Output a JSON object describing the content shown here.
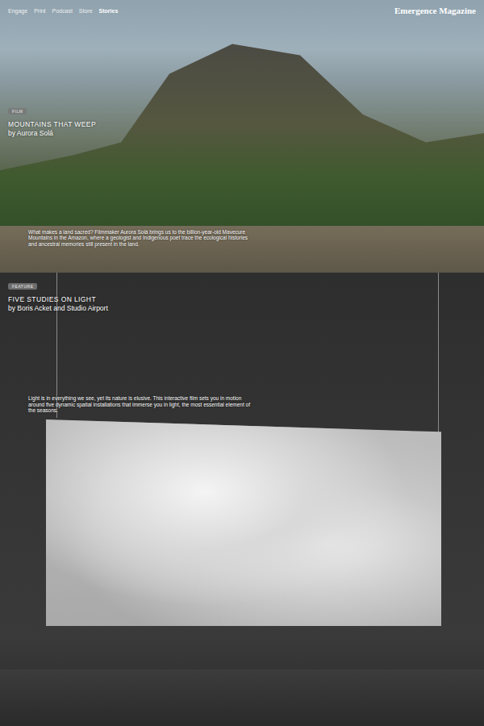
{
  "nav": {
    "links": [
      {
        "label": "Engage",
        "selected": false
      },
      {
        "label": "Print",
        "selected": false
      },
      {
        "label": "Podcast",
        "selected": false
      },
      {
        "label": "Store",
        "selected": false
      },
      {
        "label": "Stories",
        "selected": true
      }
    ],
    "logo": "Emergence Magazine"
  },
  "stories": [
    {
      "kind": "landscape",
      "badge": "FILM",
      "title": "MOUNTAINS THAT WEEP",
      "byline": "by Aurora Solá",
      "description": "What makes a land sacred? Filmmaker Aurora Solá brings us to the billion-year-old Mavecure Mountains in the Amazon, where a geologist and Indigenous poet trace the ecological histories and ancestral memories still present in the land."
    },
    {
      "kind": "installation",
      "badge": "FEATURE",
      "title": "FIVE STUDIES ON LIGHT",
      "byline": "by Boris Acket and Studio Airport",
      "description": "Light is in everything we see, yet its nature is elusive. This interactive film sets you in motion around five dynamic spatial installations that immerse you in light, the most essential element of the seasons."
    }
  ]
}
